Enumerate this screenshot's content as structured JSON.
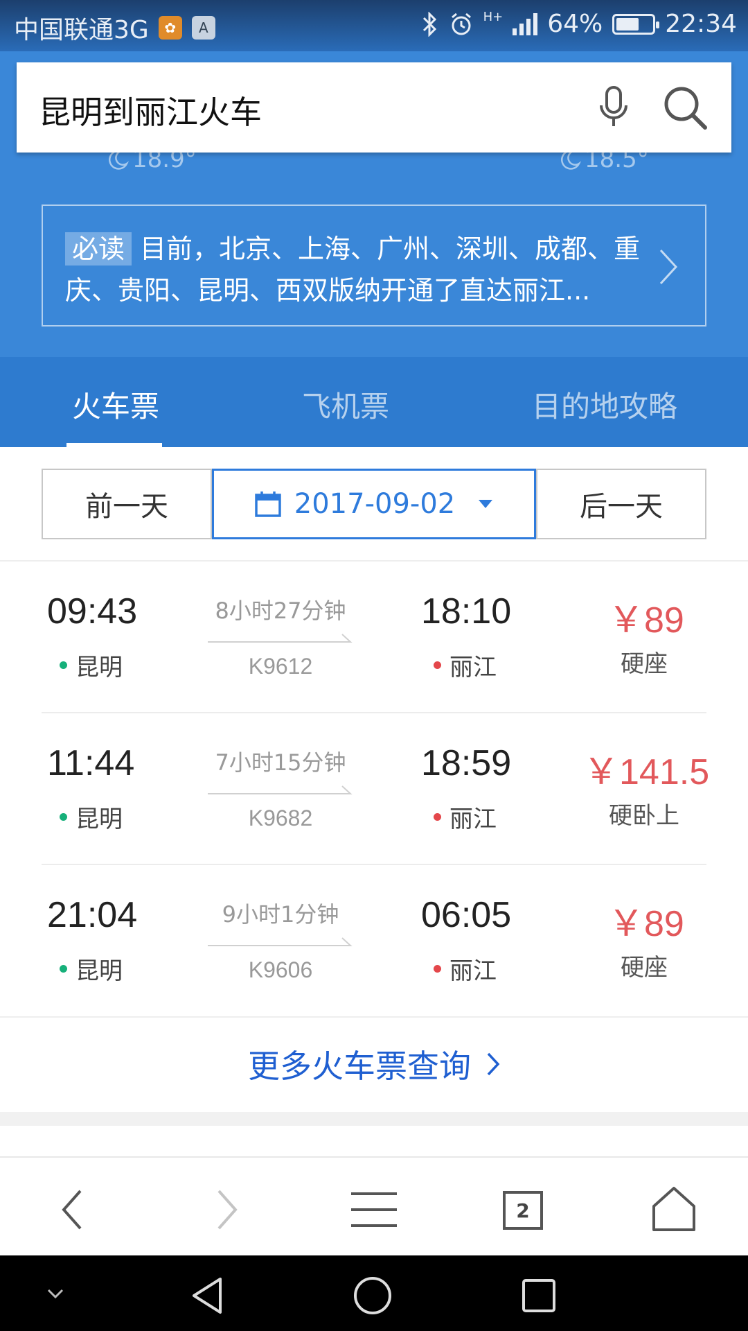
{
  "status_bar": {
    "carrier": "中国联通3G",
    "app_icon_a": "A",
    "network": "H+",
    "battery_percent": "64%",
    "battery_level": 0.64,
    "time": "22:34"
  },
  "search": {
    "query": "昆明到丽江火车"
  },
  "weather": {
    "left_temp": "18.9°",
    "right_temp": "18.5°"
  },
  "notice": {
    "badge": "必读",
    "text": "目前，北京、上海、广州、深圳、成都、重庆、贵阳、昆明、西双版纳开通了直达丽江..."
  },
  "tabs": [
    {
      "label": "火车票",
      "active": true
    },
    {
      "label": "飞机票",
      "active": false
    },
    {
      "label": "目的地攻略",
      "active": false
    }
  ],
  "date_selector": {
    "prev_label": "前一天",
    "date": "2017-09-02",
    "next_label": "后一天"
  },
  "trains": [
    {
      "dep_time": "09:43",
      "dep_station": "昆明",
      "duration": "8小时27分钟",
      "train_no": "K9612",
      "arr_time": "18:10",
      "arr_station": "丽江",
      "price": "￥89",
      "seat": "硬座"
    },
    {
      "dep_time": "11:44",
      "dep_station": "昆明",
      "duration": "7小时15分钟",
      "train_no": "K9682",
      "arr_time": "18:59",
      "arr_station": "丽江",
      "price": "￥141.5",
      "seat": "硬卧上"
    },
    {
      "dep_time": "21:04",
      "dep_station": "昆明",
      "duration": "9小时1分钟",
      "train_no": "K9606",
      "arr_time": "06:05",
      "arr_station": "丽江",
      "price": "￥89",
      "seat": "硬座"
    }
  ],
  "more_link": "更多火车票查询",
  "browser_bar": {
    "tab_count": "2"
  },
  "colors": {
    "brand_blue": "#3a87d8",
    "tab_blue": "#2e7bcf",
    "link_blue": "#1f5fd1",
    "price_red": "#e2585b"
  }
}
